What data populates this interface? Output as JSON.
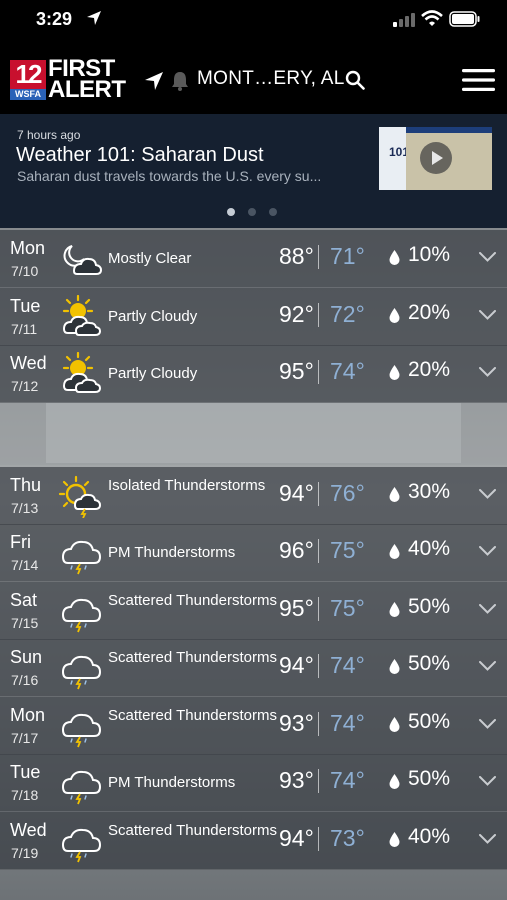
{
  "status_bar": {
    "time": "3:29"
  },
  "header": {
    "logo_number": "12",
    "logo_station": "WSFA",
    "logo_first": "FIRST",
    "logo_alert": "ALERT",
    "location": "MONT…ERY, AL"
  },
  "news": {
    "time_ago": "7 hours ago",
    "title": "Weather 101: Saharan Dust",
    "summary": "Saharan dust travels towards the U.S. every su...",
    "thumbnail_text": "101",
    "carousel_active_index": 0,
    "carousel_count": 3
  },
  "forecast": [
    {
      "day": "Mon",
      "date": "7/10",
      "icon": "night-mostly-clear-icon",
      "condition": "Mostly Clear",
      "high": "88°",
      "low": "71°",
      "precip": "10%"
    },
    {
      "day": "Tue",
      "date": "7/11",
      "icon": "partly-cloudy-icon",
      "condition": "Partly Cloudy",
      "high": "92°",
      "low": "72°",
      "precip": "20%"
    },
    {
      "day": "Wed",
      "date": "7/12",
      "icon": "partly-cloudy-icon",
      "condition": "Partly Cloudy",
      "high": "95°",
      "low": "74°",
      "precip": "20%"
    },
    {
      "day": "Thu",
      "date": "7/13",
      "icon": "sun-thunderstorm-icon",
      "condition": "Isolated Thunderstorms",
      "high": "94°",
      "low": "76°",
      "precip": "30%"
    },
    {
      "day": "Fri",
      "date": "7/14",
      "icon": "thunderstorm-icon",
      "condition": "PM Thunderstorms",
      "high": "96°",
      "low": "75°",
      "precip": "40%"
    },
    {
      "day": "Sat",
      "date": "7/15",
      "icon": "thunderstorm-icon",
      "condition": "Scattered Thunderstorms",
      "high": "95°",
      "low": "75°",
      "precip": "50%"
    },
    {
      "day": "Sun",
      "date": "7/16",
      "icon": "thunderstorm-icon",
      "condition": "Scattered Thunderstorms",
      "high": "94°",
      "low": "74°",
      "precip": "50%"
    },
    {
      "day": "Mon",
      "date": "7/17",
      "icon": "thunderstorm-icon",
      "condition": "Scattered Thunderstorms",
      "high": "93°",
      "low": "74°",
      "precip": "50%"
    },
    {
      "day": "Tue",
      "date": "7/18",
      "icon": "thunderstorm-icon",
      "condition": "PM Thunderstorms",
      "high": "93°",
      "low": "74°",
      "precip": "50%"
    },
    {
      "day": "Wed",
      "date": "7/19",
      "icon": "thunderstorm-icon",
      "condition": "Scattered Thunderstorms",
      "high": "94°",
      "low": "73°",
      "precip": "40%"
    }
  ],
  "colors": {
    "brand_red": "#c8102e",
    "brand_blue": "#2a62b7",
    "low_temp": "#8fb0d4",
    "sun": "#f2c200"
  }
}
